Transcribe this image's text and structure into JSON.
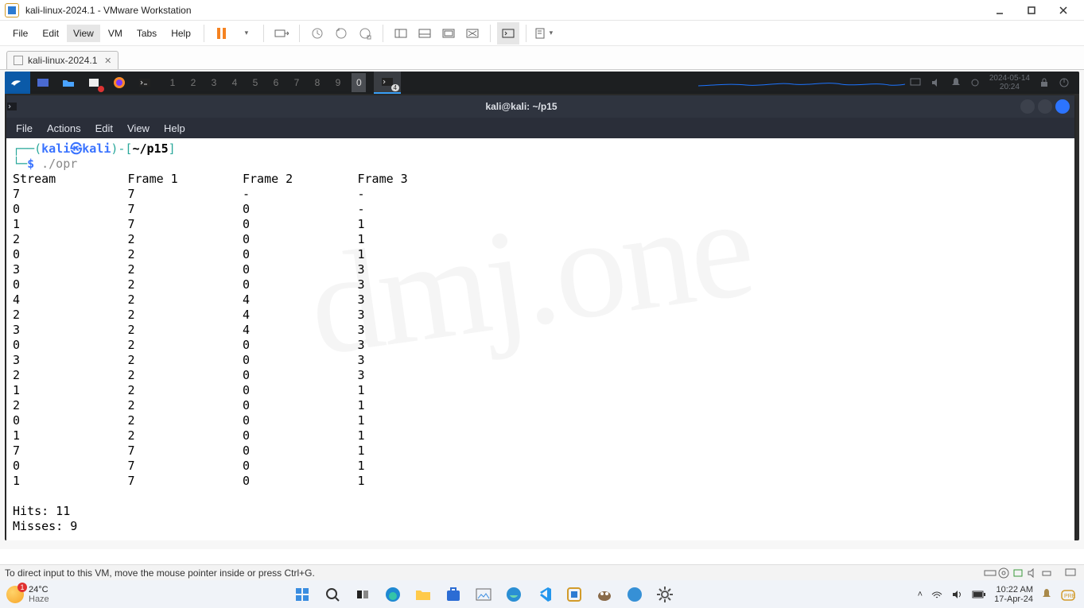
{
  "window": {
    "title": "kali-linux-2024.1 - VMware Workstation"
  },
  "menu": {
    "file": "File",
    "edit": "Edit",
    "view": "View",
    "vm": "VM",
    "tabs": "Tabs",
    "help": "Help"
  },
  "vm_tab": {
    "label": "kali-linux-2024.1"
  },
  "kali": {
    "workspaces": [
      "1",
      "2",
      "3",
      "4",
      "5",
      "6",
      "7",
      "8",
      "9",
      "0"
    ],
    "active_ws": "0",
    "task_badge": "4",
    "clock_date": "2024-05-14",
    "clock_time": "20:24"
  },
  "terminal": {
    "title": "kali@kali: ~/p15",
    "menus": [
      "File",
      "Actions",
      "Edit",
      "View",
      "Help"
    ],
    "prompt_user": "kali㉿kali",
    "prompt_path": "~/p15",
    "command": "./opr",
    "headers": [
      "Stream",
      "Frame 1",
      "Frame 2",
      "Frame 3"
    ],
    "rows": [
      [
        "7",
        "7",
        "-",
        "-"
      ],
      [
        "0",
        "7",
        "0",
        "-"
      ],
      [
        "1",
        "7",
        "0",
        "1"
      ],
      [
        "2",
        "2",
        "0",
        "1"
      ],
      [
        "0",
        "2",
        "0",
        "1"
      ],
      [
        "3",
        "2",
        "0",
        "3"
      ],
      [
        "0",
        "2",
        "0",
        "3"
      ],
      [
        "4",
        "2",
        "4",
        "3"
      ],
      [
        "2",
        "2",
        "4",
        "3"
      ],
      [
        "3",
        "2",
        "4",
        "3"
      ],
      [
        "0",
        "2",
        "0",
        "3"
      ],
      [
        "3",
        "2",
        "0",
        "3"
      ],
      [
        "2",
        "2",
        "0",
        "3"
      ],
      [
        "1",
        "2",
        "0",
        "1"
      ],
      [
        "2",
        "2",
        "0",
        "1"
      ],
      [
        "0",
        "2",
        "0",
        "1"
      ],
      [
        "1",
        "2",
        "0",
        "1"
      ],
      [
        "7",
        "7",
        "0",
        "1"
      ],
      [
        "0",
        "7",
        "0",
        "1"
      ],
      [
        "1",
        "7",
        "0",
        "1"
      ]
    ],
    "hits": "Hits: 11",
    "misses": "Misses: 9"
  },
  "status": {
    "hint": "To direct input to this VM, move the mouse pointer inside or press Ctrl+G."
  },
  "host": {
    "weather_temp": "24°C",
    "weather_label": "Haze",
    "time": "10:22 AM",
    "date": "17-Apr-24"
  },
  "watermark": "dmj.one"
}
